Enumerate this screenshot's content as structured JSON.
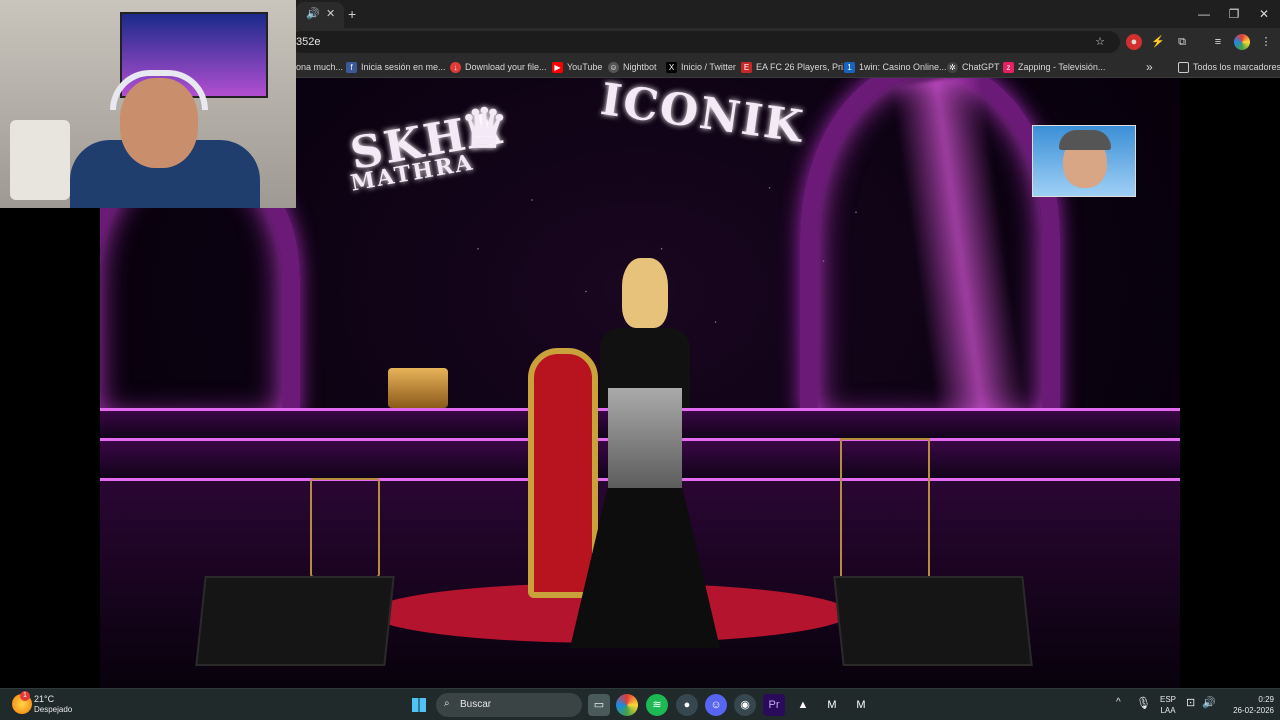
{
  "browser": {
    "tab_title_fragment": "",
    "address": "352e",
    "bookmarks": [
      {
        "label": "ona much...",
        "icon": "bookmark-icon"
      },
      {
        "label": "Inicia sesión en me...",
        "icon": "facebook-icon"
      },
      {
        "label": "Download your file...",
        "icon": "download-icon"
      },
      {
        "label": "YouTube",
        "icon": "youtube-icon"
      },
      {
        "label": "Nightbot",
        "icon": "nightbot-icon"
      },
      {
        "label": "Inicio / Twitter",
        "icon": "x-icon"
      },
      {
        "label": "EA FC 26 Players, Pri...",
        "icon": "ea-icon"
      },
      {
        "label": "1win: Casino Online...",
        "icon": "casino-icon"
      },
      {
        "label": "ChatGPT",
        "icon": "chatgpt-icon"
      },
      {
        "label": "Zapping - Televisión...",
        "icon": "zapping-icon"
      }
    ],
    "all_bookmarks": "Todos los marcadores"
  },
  "video": {
    "logo_left": "SKHA",
    "logo_left_sub": "MATHRA",
    "logo_right": "ICONIK"
  },
  "taskbar": {
    "weather_temp": "21°C",
    "weather_desc": "Despejado",
    "search_placeholder": "Buscar",
    "lang_top": "ESP",
    "lang_bottom": "LAA",
    "time": "0:29",
    "date": "26-02-2026",
    "notification_count": "1"
  },
  "colors": {
    "accent": "#e36bf0",
    "stage_purple": "#6b1a78",
    "carpet_red": "#b4142d"
  }
}
